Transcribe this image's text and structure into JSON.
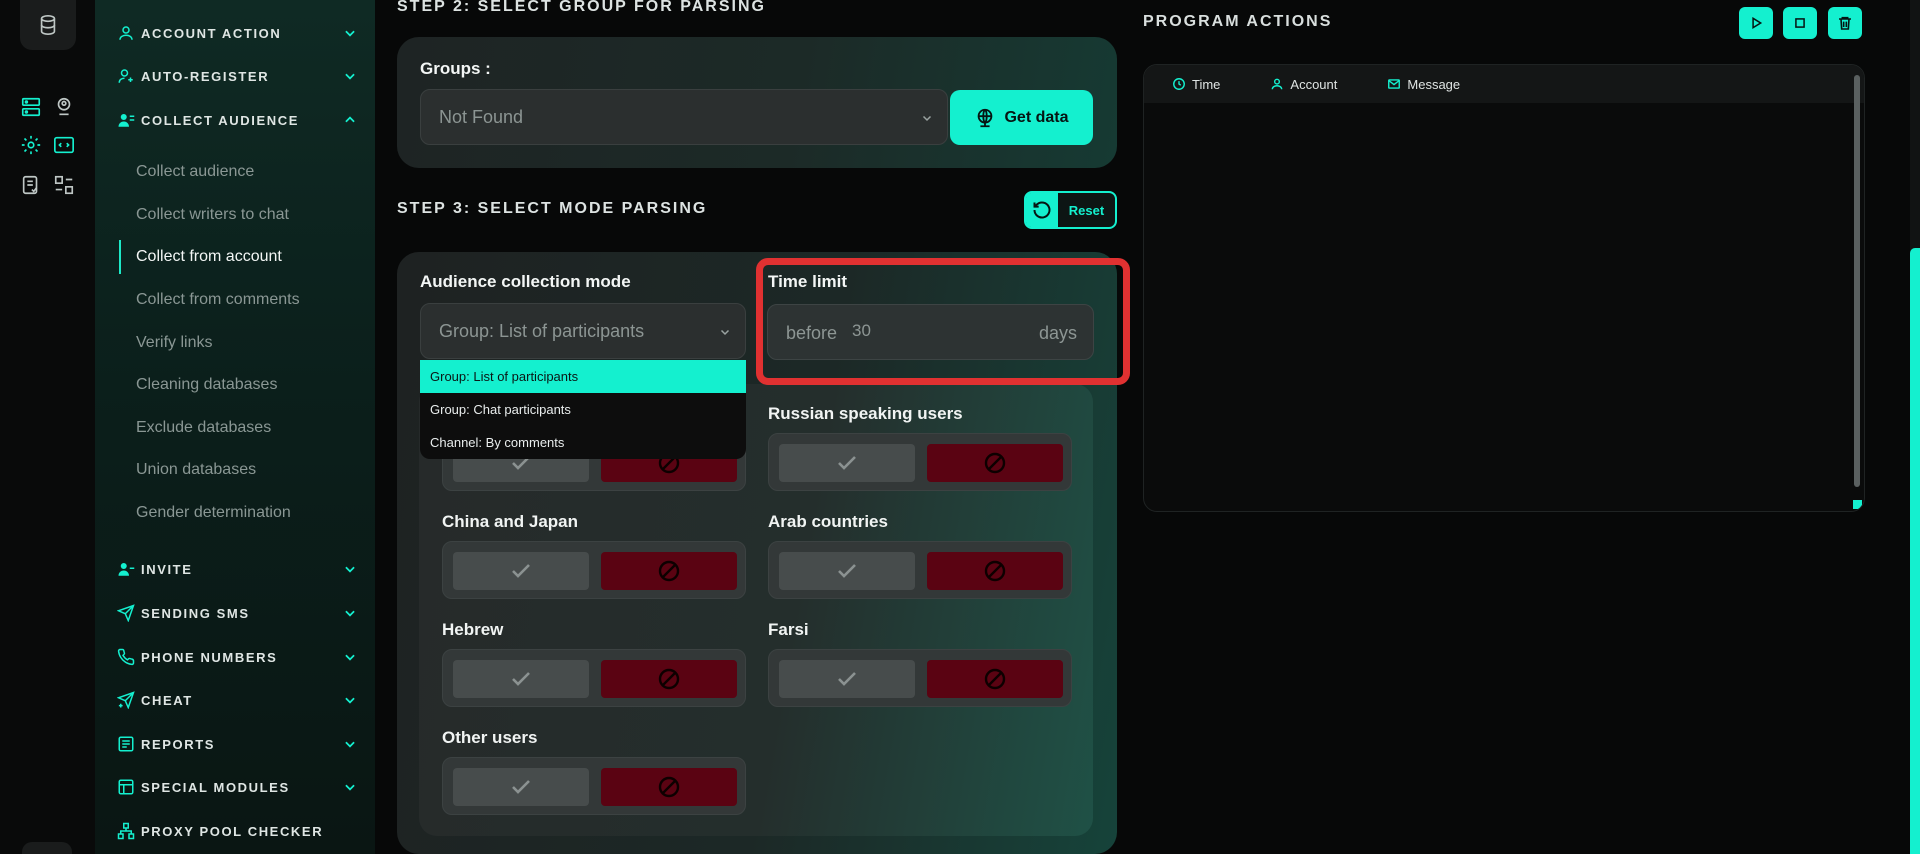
{
  "sidebar": {
    "sections": [
      {
        "label": "ACCOUNT ACTION",
        "icon": "user-check-icon"
      },
      {
        "label": "AUTO-REGISTER",
        "icon": "user-plus-icon"
      },
      {
        "label": "COLLECT AUDIENCE",
        "icon": "users-list-icon",
        "expanded": true
      },
      {
        "label": "INVITE",
        "icon": "user-invite-icon"
      },
      {
        "label": "SENDING SMS",
        "icon": "send-icon"
      },
      {
        "label": "PHONE NUMBERS",
        "icon": "phone-icon"
      },
      {
        "label": "CHEAT",
        "icon": "send-plus-icon"
      },
      {
        "label": "REPORTS",
        "icon": "report-icon"
      },
      {
        "label": "SPECIAL MODULES",
        "icon": "modules-icon"
      },
      {
        "label": "PROXY POOL CHECKER",
        "icon": "network-icon"
      }
    ],
    "sub_items": [
      "Collect audience",
      "Collect writers to chat",
      "Collect from account",
      "Collect from comments",
      "Verify links",
      "Cleaning databases",
      "Exclude databases",
      "Union databases",
      "Gender determination"
    ],
    "active_sub_item": "Collect from account"
  },
  "step2": {
    "title": "STEP 2: SELECT GROUP FOR PARSING",
    "groups_label": "Groups :",
    "groups_value": "Not Found",
    "get_data_label": "Get data"
  },
  "step3": {
    "title": "STEP 3: SELECT MODE PARSING",
    "reset_label": "Reset",
    "mode_label": "Audience collection mode",
    "mode_value": "Group: List of participants",
    "mode_options": [
      "Group: List of participants",
      "Group: Chat participants",
      "Channel: By comments"
    ],
    "time_limit_label": "Time limit",
    "time_prefix": "before",
    "time_value": "30",
    "time_suffix": "days",
    "filters": [
      {
        "label": "Russian speaking users"
      },
      {
        "label": "China and Japan"
      },
      {
        "label": "Arab countries"
      },
      {
        "label": "Hebrew"
      },
      {
        "label": "Farsi"
      },
      {
        "label": "Other users"
      }
    ],
    "hidden_filter_fragment": "sers"
  },
  "program_actions": {
    "title": "PROGRAM ACTIONS",
    "columns": [
      "Time",
      "Account",
      "Message"
    ]
  },
  "colors": {
    "accent": "#14f0cf",
    "danger": "#5a0312",
    "highlight": "#e03131"
  }
}
